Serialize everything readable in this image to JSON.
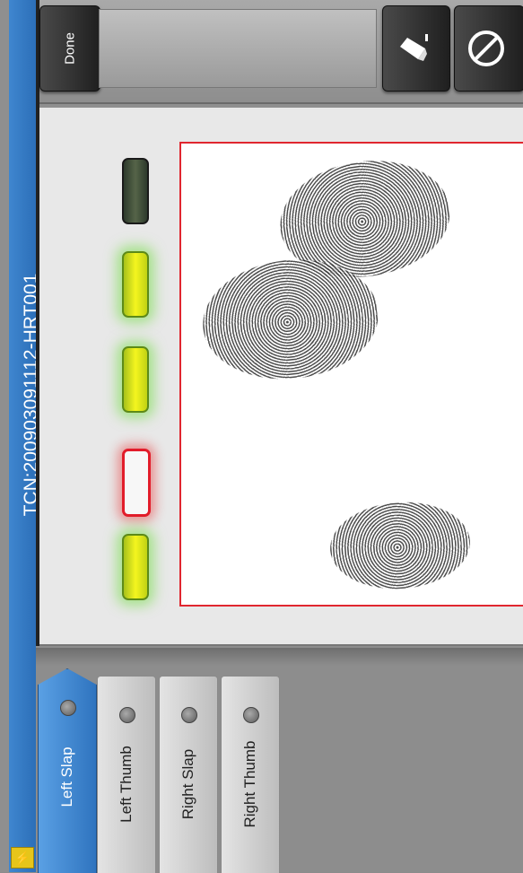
{
  "window": {
    "title": "TCN:200903091112-HRT001"
  },
  "toolbar": {
    "done_label": "Done",
    "erase_icon": "eraser-icon",
    "cancel_icon": "no-entry-icon"
  },
  "quality_indicators": [
    {
      "finger": 1,
      "status": "off"
    },
    {
      "finger": 2,
      "status": "good"
    },
    {
      "finger": 3,
      "status": "good"
    },
    {
      "finger": 4,
      "status": "bad"
    },
    {
      "finger": 5,
      "status": "good"
    }
  ],
  "colors": {
    "accent_blue": "#2f74bf",
    "good_led": "#f4f51f",
    "bad_led": "#e21c2a",
    "capture_border": "#e0262f"
  },
  "tabs": [
    {
      "label": "Left Slap",
      "active": true
    },
    {
      "label": "Left Thumb",
      "active": false
    },
    {
      "label": "Right Slap",
      "active": false
    },
    {
      "label": "Right Thumb",
      "active": false
    }
  ]
}
